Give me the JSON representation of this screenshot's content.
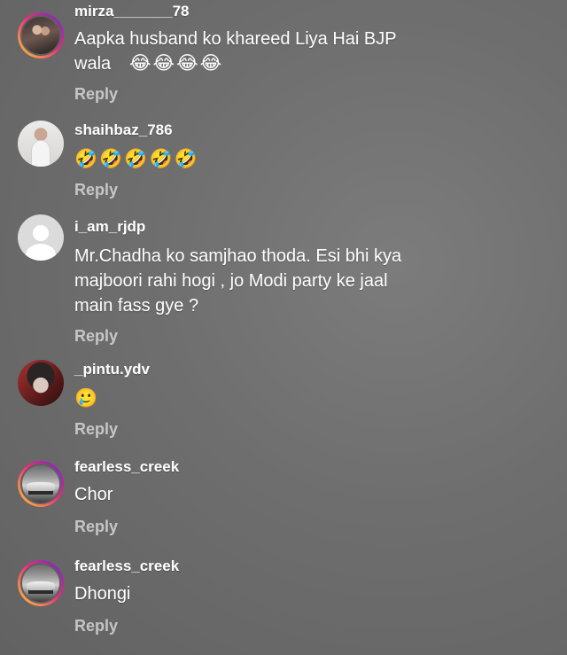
{
  "comments": [
    {
      "username": "mirza_______78",
      "text": "Aapka husband ko khareed Liya Hai BJP\nwala",
      "emoji": "😂😂😂😂",
      "reply": "Reply",
      "avatar": "couple-photo-avatar"
    },
    {
      "username": "shaihbaz_786",
      "text": "",
      "emoji": "🤣🤣🤣🤣🤣",
      "reply": "Reply",
      "avatar": "man-photo-avatar"
    },
    {
      "username": "i_am_rjdp",
      "text": "Mr.Chadha ko samjhao thoda. Esi bhi kya\nmajboori rahi hogi , jo Modi party ke jaal\nmain fass gye ?",
      "emoji": "",
      "reply": "Reply",
      "avatar": "default-avatar"
    },
    {
      "username": "_pintu.ydv",
      "text": "",
      "emoji": "🥲",
      "reply": "Reply",
      "avatar": "anime-avatar"
    },
    {
      "username": "fearless_creek",
      "text": "Chor",
      "emoji": "",
      "reply": "Reply",
      "avatar": "car-photo-avatar"
    },
    {
      "username": "fearless_creek",
      "text": "Dhongi",
      "emoji": "",
      "reply": "Reply",
      "avatar": "car-photo-avatar"
    }
  ],
  "colors": {
    "background": "#6e6e6e",
    "text": "#ffffff",
    "reply": "#b4b4b4",
    "story_ring_start": "#f9ce34",
    "story_ring_mid": "#ee2a7b",
    "story_ring_end": "#6228d7"
  }
}
